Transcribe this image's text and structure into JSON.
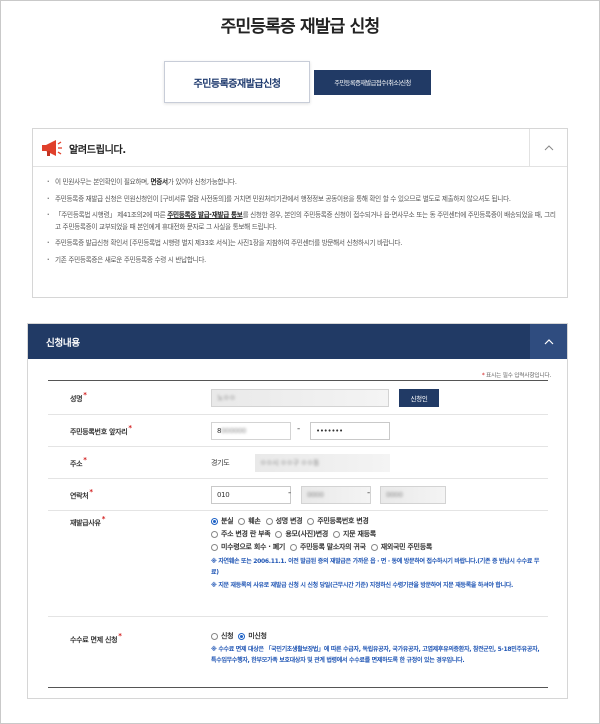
{
  "page_title": "주민등록증 재발급 신청",
  "tabs": {
    "active": "주민등록증재발급신청",
    "other": "주민등록증재발급접수(취소)신청"
  },
  "notice": {
    "title": "알려드립니다.",
    "items": [
      "이 민원사무는 본인확인이 필요하며, ",
      "주민등록증 재발급 신청은 민원신청인이 [구비서류 열람 사전동의]를 거치면 민원처리기관에서 행정정보 공동이용을 통해 확인 할 수 있으므로 별도로 제출하지 않으셔도 됩니다.",
      "「주민등록법 시행령」 제41조의2에 따른 ",
      "주민등록증 발급신청 확인서 [주민등록법 시행령 별지 제33호 서식]는 사진1장을 지참하여 주민센터를 방문해서 신청하시기 바랍니다.",
      "기존 주민등록증은 새로운 주민등록증 수령 시 반납합니다."
    ],
    "item0_bold": "면증서",
    "item0_tail": "가 있어야 신청가능합니다.",
    "item2_underline": "주민등록증 발급·재발급 통보",
    "item2_tail": "를 신청한 경우, 본인의 주민등록증 신청이 접수되거나 읍·면사무소 또는 동 주민센터에 주민등록증이 배송되었을 때, 그리고 주민등록증이 교부되었을 때 본인에게 휴대전화 문자로 그 사실을 통보해 드립니다."
  },
  "apply": {
    "title": "신청내용",
    "required_note": "표시는 필수 입력사항입니다.",
    "name": {
      "label": "성명",
      "value": "노ㅇㅇ",
      "button": "신청인"
    },
    "rrn": {
      "label": "주민등록번호 앞자리",
      "front": "8",
      "back": "•••••••"
    },
    "address": {
      "label": "주소",
      "sido": "경기도",
      "detail": "ㅇㅇ시 ㅇㅇ구 ㅇㅇ동"
    },
    "phone": {
      "label": "연락처",
      "p1": "010",
      "p2": "0000",
      "p3": "0000"
    },
    "reason": {
      "label": "재발급사유",
      "row1": [
        "분실",
        "훼손",
        "성명 변경",
        "주민등록번호 변경"
      ],
      "row2": [
        "주소 변경 란 부족",
        "용모(사진)변경",
        "지문 재등록"
      ],
      "row3": [
        "미수령으로 회수 · 폐기",
        "주민등록 말소자의 귀국",
        "재외국민 주민등록"
      ],
      "note1": "※ 자연훼손 또는 2006.11.1. 이전 발급된 증의 재발급은 가까운 읍 · 면 · 동에 방문하여 접수하시기 바랍니다.(기존 증 반납시 수수료 무료)",
      "note2": "※ 지문 재등록의 사유로 재발급 신청 시 신청 당일(근무시간 기준) 지정하신 수령기관을 방문하여 지문 재등록을 하셔야 합니다."
    },
    "fee": {
      "label": "수수료 면제 신청",
      "options": [
        "신청",
        "미신청"
      ],
      "note": "※ 수수료 면제 대상은 「국민기초생활보장법」에 따른 수급자, 독립유공자, 국가유공자, 고엽제후유의증환자, 참전군인, 5·18민주유공자, 특수임무수행자, 한부모가족 보호대상자 및 관계 법령에서 수수료를 면제하도록 한 규정이 있는 경우입니다."
    }
  },
  "colors": {
    "navy": "#213a65",
    "blue_note": "#1f55b4",
    "required": "#d21f1f"
  }
}
